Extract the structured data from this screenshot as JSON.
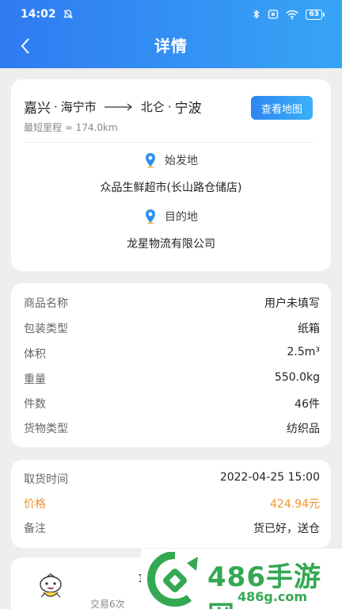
{
  "status": {
    "time": "14:02",
    "battery": "63"
  },
  "header": {
    "title": "详情"
  },
  "route": {
    "from_city": "嘉兴",
    "from_district": "海宁市",
    "to_district": "北仑",
    "to_city": "宁波",
    "separator": "·",
    "distance": "最短里程 ≈ 174.0km",
    "map_button": "查看地图",
    "origin_label": "始发地",
    "origin_name": "众品生鲜超市(长山路仓储店)",
    "dest_label": "目的地",
    "dest_name": "龙星物流有限公司"
  },
  "goods": [
    {
      "key": "商品名称",
      "value": "用户未填写"
    },
    {
      "key": "包装类型",
      "value": "纸箱"
    },
    {
      "key": "体积",
      "value": "2.5m³"
    },
    {
      "key": "重量",
      "value": "550.0kg"
    },
    {
      "key": "件数",
      "value": "46件"
    },
    {
      "key": "货物类型",
      "value": "纺织品"
    }
  ],
  "order": [
    {
      "key": "取货时间",
      "value": "2022-04-25 15:00"
    },
    {
      "key": "价格",
      "value": "424.94元"
    },
    {
      "key": "备注",
      "value": "货已好，送仓"
    }
  ],
  "shipper": {
    "trades": "交易6次",
    "partial": "1"
  },
  "watermark": {
    "brand": "486手游网",
    "url": "486g.com"
  },
  "colors": {
    "header_start": "#2f7bf1",
    "header_end": "#37a4f6",
    "price": "#f0932b",
    "pin": "#2f8ff3",
    "watermark": "#34a853"
  }
}
